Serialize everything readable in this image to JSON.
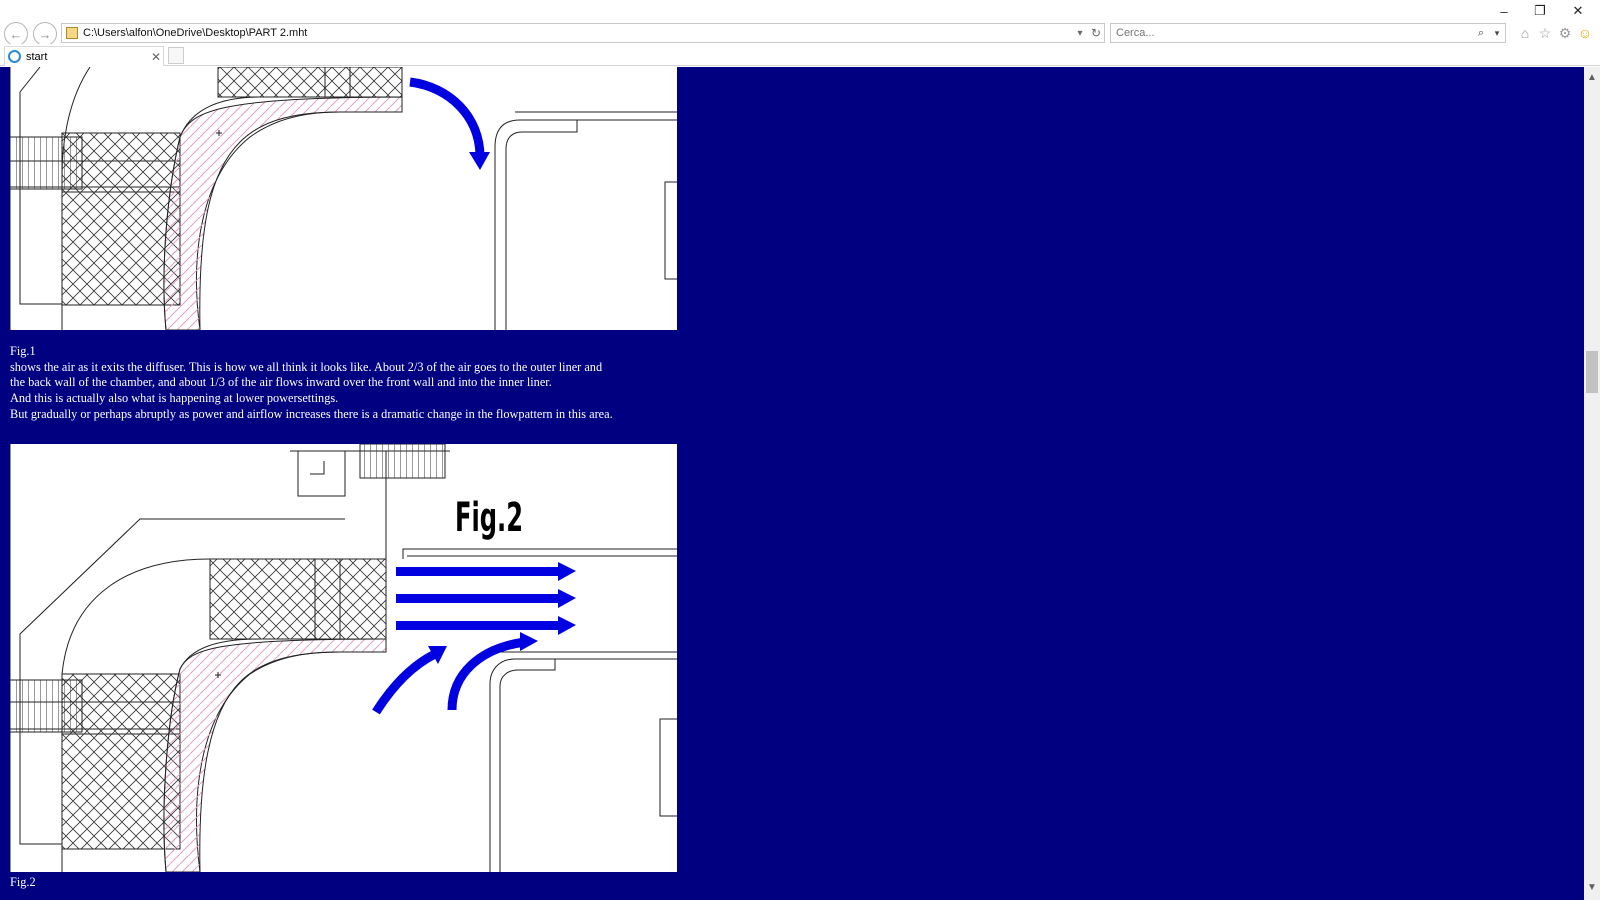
{
  "browser": {
    "address": "C:\\Users\\alfon\\OneDrive\\Desktop\\PART 2.mht",
    "search_placeholder": "Cerca...",
    "tab_title": "start"
  },
  "page": {
    "background": "#000080",
    "figure1_caption": {
      "label": "Fig.1",
      "lines": [
        "shows the air as it exits the diffuser. This is how we all think it looks like. About 2/3 of the air goes to the outer liner and",
        "the back wall of the chamber, and about 1/3 of the air flows inward over the front wall and into the inner liner.",
        "And this is actually also what is happening at lower powersettings.",
        "But gradually or perhaps abruptly as power and airflow increases there is a dramatic change in the flowpattern in this area."
      ]
    },
    "figure2_title": "Fig.2",
    "figure2_caption": {
      "label": "Fig.2"
    },
    "colors": {
      "arrow": "#0000e0",
      "hatch_pink": "#e0a0c8"
    }
  }
}
